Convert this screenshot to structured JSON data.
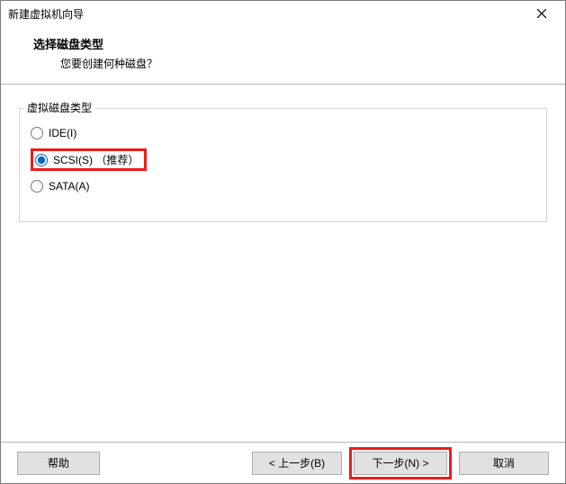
{
  "window": {
    "title": "新建虚拟机向导"
  },
  "header": {
    "title": "选择磁盘类型",
    "subtitle": "您要创建何种磁盘？"
  },
  "group": {
    "legend": "虚拟磁盘类型",
    "options": {
      "ide": {
        "label": "IDE(I)",
        "selected": false
      },
      "scsi": {
        "label": "SCSI(S) （推荐）",
        "selected": true
      },
      "sata": {
        "label": "SATA(A)",
        "selected": false
      }
    }
  },
  "buttons": {
    "help": "帮助",
    "back": "< 上一步(B)",
    "next": "下一步(N) >",
    "cancel": "取消"
  },
  "highlight": {
    "scsi_option": true,
    "next_button": true
  }
}
